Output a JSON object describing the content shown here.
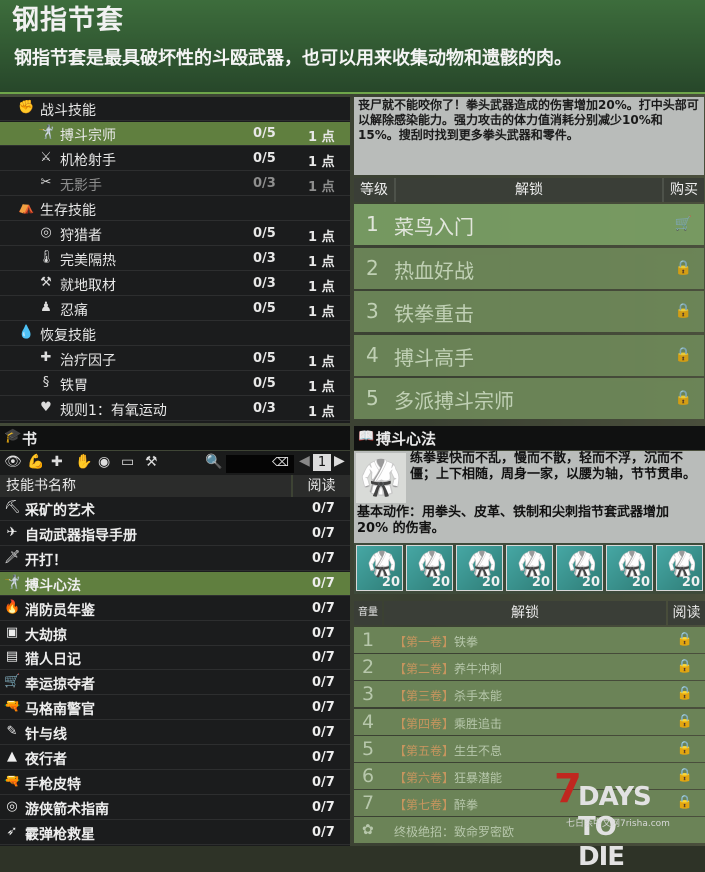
{
  "banner": {
    "title": "钢指节套",
    "description": "钢指节套是最具破坏性的斗殴武器，也可以用来收集动物和遗骸的肉。"
  },
  "skills": [
    {
      "type": "category",
      "icon": "fist-icon",
      "name": "战斗技能"
    },
    {
      "type": "skill",
      "icon": "brawler-icon",
      "name": "搏斗宗师",
      "level": "0/5",
      "points": "1 点",
      "selected": true
    },
    {
      "type": "skill",
      "icon": "gun-icon",
      "name": "机枪射手",
      "level": "0/5",
      "points": "1 点"
    },
    {
      "type": "skill",
      "icon": "swords-icon",
      "name": "无影手",
      "level": "0/3",
      "points": "1 点",
      "dim": true
    },
    {
      "type": "category",
      "icon": "survival-icon",
      "name": "生存技能"
    },
    {
      "type": "skill",
      "icon": "target-icon",
      "name": "狩猎者",
      "level": "0/5",
      "points": "1 点"
    },
    {
      "type": "skill",
      "icon": "thermometer-icon",
      "name": "完美隔热",
      "level": "0/3",
      "points": "1 点"
    },
    {
      "type": "skill",
      "icon": "harvest-icon",
      "name": "就地取材",
      "level": "0/3",
      "points": "1 点"
    },
    {
      "type": "skill",
      "icon": "meditate-icon",
      "name": "忍痛",
      "level": "0/5",
      "points": "1 点"
    },
    {
      "type": "category",
      "icon": "drop-icon",
      "name": "恢复技能"
    },
    {
      "type": "skill",
      "icon": "heal-icon",
      "name": "治疗因子",
      "level": "0/5",
      "points": "1 点"
    },
    {
      "type": "skill",
      "icon": "stomach-icon",
      "name": "铁胃",
      "level": "0/5",
      "points": "1 点"
    },
    {
      "type": "skill",
      "icon": "heartbeat-icon",
      "name": "规则1：有氧运动",
      "level": "0/3",
      "points": "1 点"
    }
  ],
  "perk": {
    "description": "丧尸就不能咬你了！拳头武器造成的伤害增加20%。打中头部可以解除感染能力。强力攻击的体力值消耗分别减少10%和15%。搜刮时找到更多拳头武器和零件。",
    "headers": {
      "level": "等级",
      "unlock": "解锁",
      "buy": "购买"
    },
    "levels": [
      {
        "num": "1",
        "name": "菜鸟入门",
        "icon": "cart-icon",
        "active": true
      },
      {
        "num": "2",
        "name": "热血好战",
        "icon": "lock-icon"
      },
      {
        "num": "3",
        "name": "铁拳重击",
        "icon": "lock-icon"
      },
      {
        "num": "4",
        "name": "搏斗高手",
        "icon": "lock-icon"
      },
      {
        "num": "5",
        "name": "多派搏斗宗师",
        "icon": "lock-icon"
      }
    ]
  },
  "books": {
    "title": "书",
    "page": "1",
    "headers": {
      "name": "技能书名称",
      "read": "阅读"
    },
    "items": [
      {
        "icon": "pickaxe-icon",
        "name": "采矿的艺术",
        "progress": "0/7"
      },
      {
        "icon": "rifle-icon",
        "name": "自动武器指导手册",
        "progress": "0/7"
      },
      {
        "icon": "knife-icon",
        "name": "开打！",
        "progress": "0/7"
      },
      {
        "icon": "brawler-icon",
        "name": "搏斗心法",
        "progress": "0/7",
        "selected": true
      },
      {
        "icon": "fire-icon",
        "name": "消防员年鉴",
        "progress": "0/7"
      },
      {
        "icon": "safe-icon",
        "name": "大劫掠",
        "progress": "0/7"
      },
      {
        "icon": "journal-icon",
        "name": "猎人日记",
        "progress": "0/7"
      },
      {
        "icon": "cart-icon",
        "name": "幸运掠夺者",
        "progress": "0/7"
      },
      {
        "icon": "pistol-icon",
        "name": "马格南警官",
        "progress": "0/7"
      },
      {
        "icon": "needle-icon",
        "name": "针与线",
        "progress": "0/7"
      },
      {
        "icon": "night-icon",
        "name": "夜行者",
        "progress": "0/7"
      },
      {
        "icon": "pistol2-icon",
        "name": "手枪皮特",
        "progress": "0/7"
      },
      {
        "icon": "archery-icon",
        "name": "游侠箭术指南",
        "progress": "0/7"
      },
      {
        "icon": "shotgun-icon",
        "name": "霰弹枪救星",
        "progress": "0/7"
      }
    ]
  },
  "book_detail": {
    "title": "搏斗心法",
    "quote": "练拳要快而不乱，慢而不散，轻而不浮，沉而不僵；上下相随，周身一家，以腰为轴，节节贯串。",
    "effect": "基本动作：用拳头、皮革、铁制和尖刺指节套武器增加 20% 的伤害。",
    "card_counts": [
      "20",
      "20",
      "20",
      "20",
      "20",
      "20",
      "20"
    ],
    "headers": {
      "qty": "音量",
      "unlock": "解锁",
      "read": "阅读"
    },
    "volumes": [
      {
        "num": "1",
        "vol": "【第一卷】",
        "name": "铁拳"
      },
      {
        "num": "2",
        "vol": "【第二卷】",
        "name": "养牛冲刺"
      },
      {
        "num": "3",
        "vol": "【第三卷】",
        "name": "杀手本能"
      },
      {
        "num": "4",
        "vol": "【第四卷】",
        "name": "乘胜追击"
      },
      {
        "num": "5",
        "vol": "【第五卷】",
        "name": "生生不息"
      },
      {
        "num": "6",
        "vol": "【第六卷】",
        "name": "狂暴潜能"
      },
      {
        "num": "7",
        "vol": "【第七卷】",
        "name": "醉拳"
      }
    ],
    "final": "终极绝招：致命罗密欧"
  },
  "watermark": {
    "logo": "DAYS TO DIE",
    "seven": "7",
    "site": "七日杀中文网7risha.com"
  }
}
